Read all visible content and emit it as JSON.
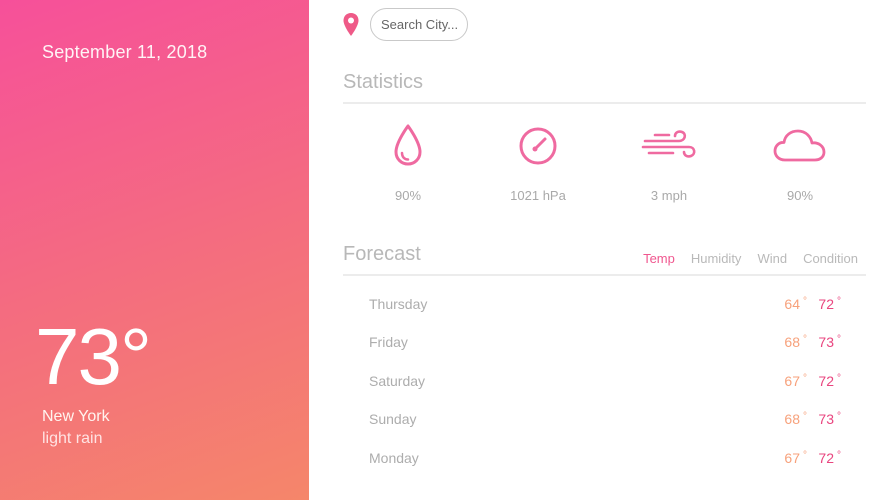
{
  "left": {
    "date": "September 11, 2018",
    "temperature": "73°",
    "city": "New York",
    "condition": "light rain"
  },
  "search": {
    "placeholder": "Search City..."
  },
  "statistics": {
    "title": "Statistics",
    "items": [
      {
        "icon": "humidity-drop-icon",
        "value": "90%"
      },
      {
        "icon": "pressure-gauge-icon",
        "value": "1021 hPa"
      },
      {
        "icon": "wind-icon",
        "value": "3 mph"
      },
      {
        "icon": "cloud-icon",
        "value": "90%"
      }
    ]
  },
  "forecast": {
    "title": "Forecast",
    "tabs": [
      "Temp",
      "Humidity",
      "Wind",
      "Condition"
    ],
    "active_tab": "Temp",
    "degree_symbol": "°",
    "rows": [
      {
        "day": "Thursday",
        "low": "64",
        "high": "72"
      },
      {
        "day": "Friday",
        "low": "68",
        "high": "73"
      },
      {
        "day": "Saturday",
        "low": "67",
        "high": "72"
      },
      {
        "day": "Sunday",
        "low": "68",
        "high": "73"
      },
      {
        "day": "Monday",
        "low": "67",
        "high": "72"
      }
    ]
  },
  "colors": {
    "accent": "#f0578f",
    "low_temp": "#f7a17b",
    "high_temp": "#e9457f",
    "gradient_start": "#f6509a",
    "gradient_end": "#f5866a"
  }
}
